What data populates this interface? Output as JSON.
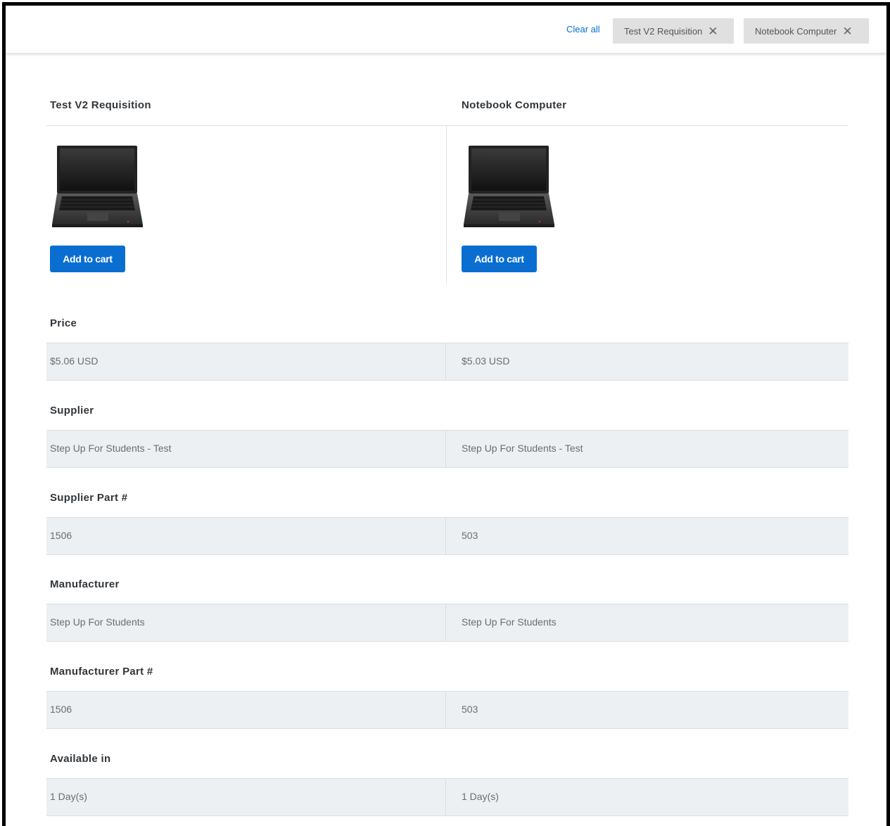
{
  "topbar": {
    "clear_all": "Clear all",
    "chips": [
      {
        "label": "Test V2 Requisition"
      },
      {
        "label": "Notebook Computer"
      }
    ]
  },
  "products": [
    {
      "title": "Test V2 Requisition",
      "add_label": "Add to cart"
    },
    {
      "title": "Notebook Computer",
      "add_label": "Add to cart"
    }
  ],
  "sections": [
    {
      "label": "Price",
      "values": [
        "$5.06 USD",
        "$5.03 USD"
      ]
    },
    {
      "label": "Supplier",
      "values": [
        "Step Up For Students - Test",
        "Step Up For Students - Test"
      ]
    },
    {
      "label": "Supplier Part #",
      "values": [
        "1506",
        "503"
      ]
    },
    {
      "label": "Manufacturer",
      "values": [
        "Step Up For Students",
        "Step Up For Students"
      ]
    },
    {
      "label": "Manufacturer Part #",
      "values": [
        "1506",
        "503"
      ]
    },
    {
      "label": "Available in",
      "values": [
        "1 Day(s)",
        "1 Day(s)"
      ]
    }
  ],
  "colors": {
    "accent": "#0a6ed1",
    "row_bg": "#edf0f3",
    "chip_bg": "#e0e0e0"
  }
}
